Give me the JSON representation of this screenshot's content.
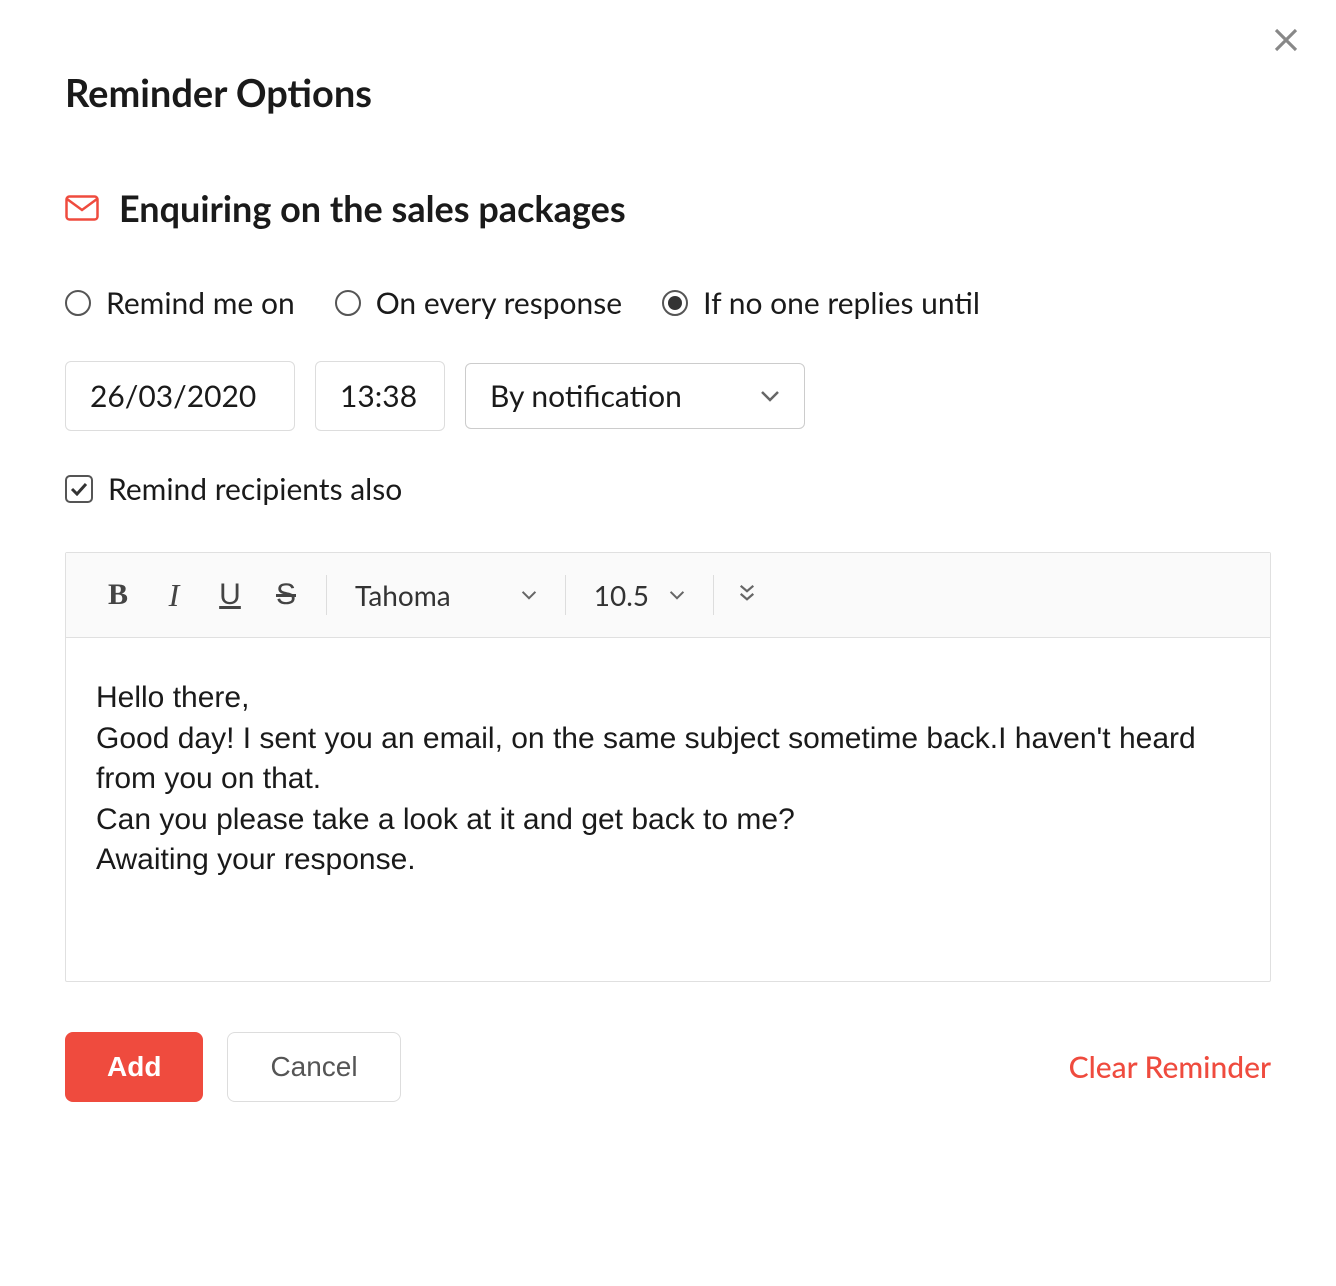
{
  "dialog": {
    "title": "Reminder Options",
    "subject": "Enquiring on the sales packages"
  },
  "radio_options": {
    "remind_me_on": {
      "label": "Remind me on",
      "selected": false
    },
    "on_every_response": {
      "label": "On every response",
      "selected": false
    },
    "if_no_one_replies": {
      "label": "If no one replies until",
      "selected": true
    }
  },
  "inputs": {
    "date": "26/03/2020",
    "time": "13:38",
    "method": "By notification"
  },
  "checkbox": {
    "remind_recipients": {
      "label": "Remind recipients also",
      "checked": true
    }
  },
  "editor": {
    "toolbar": {
      "font": "Tahoma",
      "size": "10.5"
    },
    "body": "Hello there,\nGood day! I sent you an email, on the same subject sometime back.I haven't heard from you on that.\nCan you please take a look at it and get back to me?\nAwaiting your response."
  },
  "footer": {
    "add": "Add",
    "cancel": "Cancel",
    "clear": "Clear Reminder"
  },
  "colors": {
    "accent": "#ef4b3e"
  }
}
